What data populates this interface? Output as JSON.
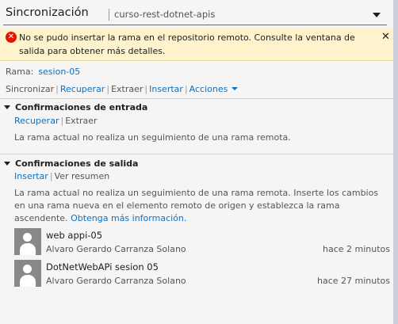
{
  "header": {
    "title": "Sincronización",
    "repo": "curso-rest-dotnet-apis"
  },
  "error": {
    "message": "No se pudo insertar la rama en el repositorio remoto. Consulte la ventana de salida para obtener más detalles.",
    "close_glyph": "✕"
  },
  "branch": {
    "label": "Rama:",
    "name": "sesion-05"
  },
  "actions": {
    "sync": "Sincronizar",
    "fetch": "Recuperar",
    "pull": "Extraer",
    "push": "Insertar",
    "more": "Acciones"
  },
  "incoming": {
    "title": "Confirmaciones de entrada",
    "fetch": "Recuperar",
    "pull": "Extraer",
    "message": "La rama actual no realiza un seguimiento de una rama remota."
  },
  "outgoing": {
    "title": "Confirmaciones de salida",
    "push": "Insertar",
    "summary": "Ver resumen",
    "message": "La rama actual no realiza un seguimiento de una rama remota. Inserte los cambios en una rama nueva en el elemento remoto de origen y establezca la rama ascendente.",
    "more_info": "Obtenga más información.",
    "commits": [
      {
        "title": "web appi-05",
        "author": "Alvaro Gerardo Carranza Solano",
        "time": "hace 2 minutos"
      },
      {
        "title": "DotNetWebAPi sesion 05",
        "author": "Alvaro Gerardo Carranza Solano",
        "time": "hace 27 minutos"
      }
    ]
  },
  "colors": {
    "link": "#0e70c0",
    "error_bg": "#fef3cd",
    "error_icon": "#e51400",
    "accent_line": "#3a6ec0"
  }
}
